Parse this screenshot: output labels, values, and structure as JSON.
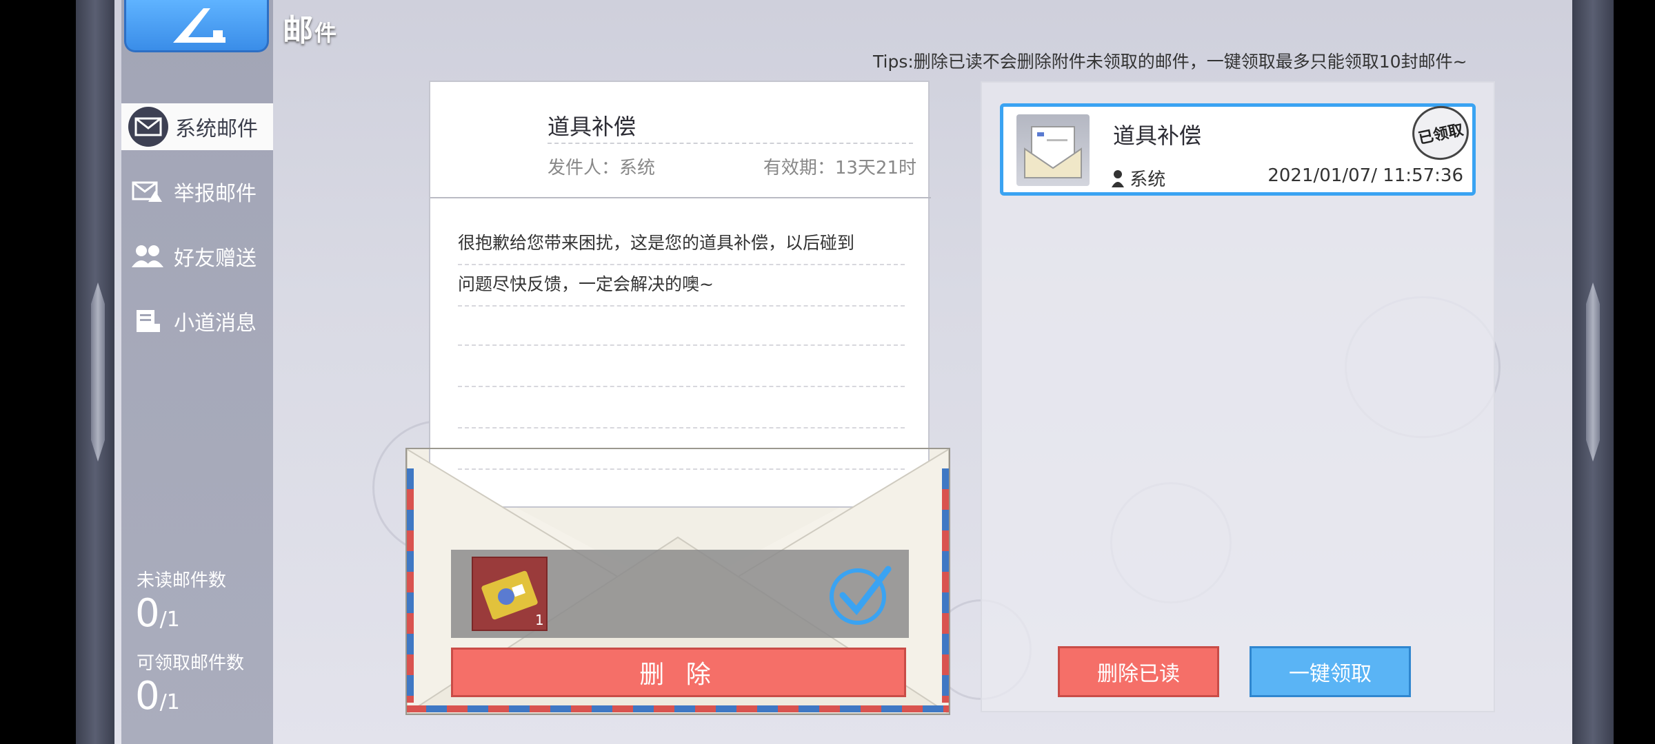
{
  "header": {
    "title_main": "邮",
    "title_rest": "件",
    "back_icon": "back-arrow-icon"
  },
  "sidebar": {
    "items": [
      {
        "label": "系统邮件",
        "icon": "system-mail-icon",
        "active": true
      },
      {
        "label": "举报邮件",
        "icon": "report-mail-icon",
        "active": false
      },
      {
        "label": "好友赠送",
        "icon": "friends-icon",
        "active": false
      },
      {
        "label": "小道消息",
        "icon": "news-icon",
        "active": false
      }
    ],
    "unread": {
      "label": "未读邮件数",
      "value": "0",
      "total": "1"
    },
    "claimable": {
      "label": "可领取邮件数",
      "value": "0",
      "total": "1"
    }
  },
  "tips": "Tips:删除已读不会删除附件未领取的邮件，一键领取最多只能领取10封邮件~",
  "letter": {
    "subject": "道具补偿",
    "sender": "发件人：系统",
    "validity": "有效期：13天21时",
    "body_lines": [
      "很抱歉给您带来困扰，这是您的道具补偿，以后碰到",
      "问题尽快反馈，一定会解决的噢~"
    ],
    "attachment": {
      "count": "1"
    },
    "delete_label": "删 除"
  },
  "mail_list": [
    {
      "title": "道具补偿",
      "sender": "系统",
      "date": "2021/01/07/ 11:57:36",
      "badge": "已领取"
    }
  ],
  "actions": {
    "delete_read": "删除已读",
    "claim_all": "一键领取"
  },
  "colors": {
    "accent_blue": "#3aa3f2",
    "danger_red": "#f56f68",
    "claim_blue": "#5ab4f5"
  }
}
